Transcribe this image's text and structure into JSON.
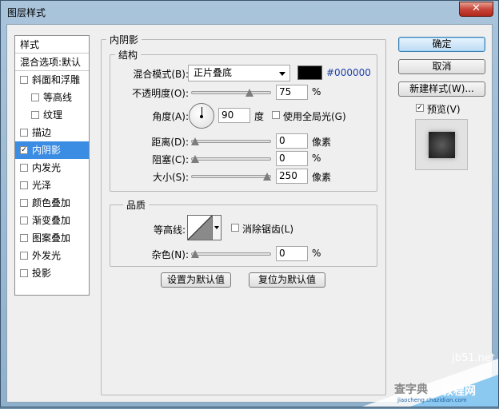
{
  "window": {
    "title": "图层样式",
    "close_glyph": "✕"
  },
  "left_panel": {
    "header": "样式",
    "blend_options": "混合选项:默认",
    "items": [
      {
        "label": "斜面和浮雕",
        "checked": false,
        "indent": 0,
        "selected": false
      },
      {
        "label": "等高线",
        "checked": false,
        "indent": 1,
        "selected": false
      },
      {
        "label": "纹理",
        "checked": false,
        "indent": 1,
        "selected": false
      },
      {
        "label": "描边",
        "checked": false,
        "indent": 0,
        "selected": false
      },
      {
        "label": "内阴影",
        "checked": true,
        "indent": 0,
        "selected": true
      },
      {
        "label": "内发光",
        "checked": false,
        "indent": 0,
        "selected": false
      },
      {
        "label": "光泽",
        "checked": false,
        "indent": 0,
        "selected": false
      },
      {
        "label": "颜色叠加",
        "checked": false,
        "indent": 0,
        "selected": false
      },
      {
        "label": "渐变叠加",
        "checked": false,
        "indent": 0,
        "selected": false
      },
      {
        "label": "图案叠加",
        "checked": false,
        "indent": 0,
        "selected": false
      },
      {
        "label": "外发光",
        "checked": false,
        "indent": 0,
        "selected": false
      },
      {
        "label": "投影",
        "checked": false,
        "indent": 0,
        "selected": false
      }
    ]
  },
  "inner_shadow": {
    "title": "内阴影",
    "structure": {
      "title": "结构",
      "blend_mode_label": "混合模式(B):",
      "blend_mode_value": "正片叠底",
      "color_hex": "#000000",
      "color": "#000000",
      "opacity_label": "不透明度(O):",
      "opacity_value": "75",
      "opacity_fraction": 0.75,
      "opacity_unit": "%",
      "angle_label": "角度(A):",
      "angle_value": "90",
      "angle_unit": "度",
      "global_light_label": "使用全局光(G)",
      "global_light_checked": false,
      "distance_label": "距离(D):",
      "distance_value": "0",
      "distance_fraction": 0.0,
      "distance_unit": "像素",
      "choke_label": "阻塞(C):",
      "choke_value": "0",
      "choke_fraction": 0.0,
      "choke_unit": "%",
      "size_label": "大小(S):",
      "size_value": "250",
      "size_fraction": 1.0,
      "size_unit": "像素"
    },
    "quality": {
      "title": "品质",
      "contour_label": "等高线:",
      "anti_alias_label": "消除锯齿(L)",
      "anti_alias_checked": false,
      "noise_label": "杂色(N):",
      "noise_value": "0",
      "noise_fraction": 0.0,
      "noise_unit": "%"
    },
    "make_default_label": "设置为默认值",
    "reset_default_label": "复位为默认值"
  },
  "buttons": {
    "ok": "确定",
    "cancel": "取消",
    "new_style": "新建样式(W)...",
    "preview_label": "预览(V)",
    "preview_checked": true
  },
  "watermark": {
    "site": "jb51.net",
    "line1": "查字典",
    "line2": "教程网",
    "line3": "jiaocheng.chazidian.com"
  },
  "colors": {
    "selection": "#3b8de4",
    "accent_button": "#bcdcf5",
    "hex_text": "#1d3fa8"
  }
}
